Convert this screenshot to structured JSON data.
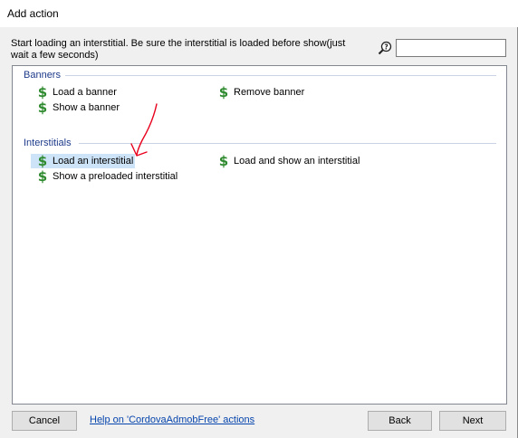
{
  "window": {
    "title": "Add action",
    "description": "Start loading an interstitial. Be sure the interstitial is loaded before show(just wait a few seconds)"
  },
  "search": {
    "placeholder": "",
    "value": "",
    "icon": "search-help-icon"
  },
  "groups": [
    {
      "header": "Banners",
      "actions": [
        {
          "label": "Load a banner",
          "icon": "dollar-icon",
          "selected": false
        },
        {
          "label": "Remove banner",
          "icon": "dollar-icon",
          "selected": false
        },
        {
          "label": "Show a banner",
          "icon": "dollar-icon",
          "selected": false
        }
      ]
    },
    {
      "header": "Interstitials",
      "actions": [
        {
          "label": "Load an interstitial",
          "icon": "dollar-icon",
          "selected": true
        },
        {
          "label": "Load and show an interstitial",
          "icon": "dollar-icon",
          "selected": false
        },
        {
          "label": "Show a preloaded interstitial",
          "icon": "dollar-icon",
          "selected": false
        }
      ]
    }
  ],
  "footer": {
    "cancel_label": "Cancel",
    "help_link": "Help on 'CordovaAdmobFree' actions",
    "back_label": "Back",
    "next_label": "Next"
  },
  "colors": {
    "group_header": "#1e3b8a",
    "dollar_icon": "#2e8a2e",
    "selection": "#cde3f7",
    "annotation": "#e8001c",
    "link": "#0645ad"
  }
}
